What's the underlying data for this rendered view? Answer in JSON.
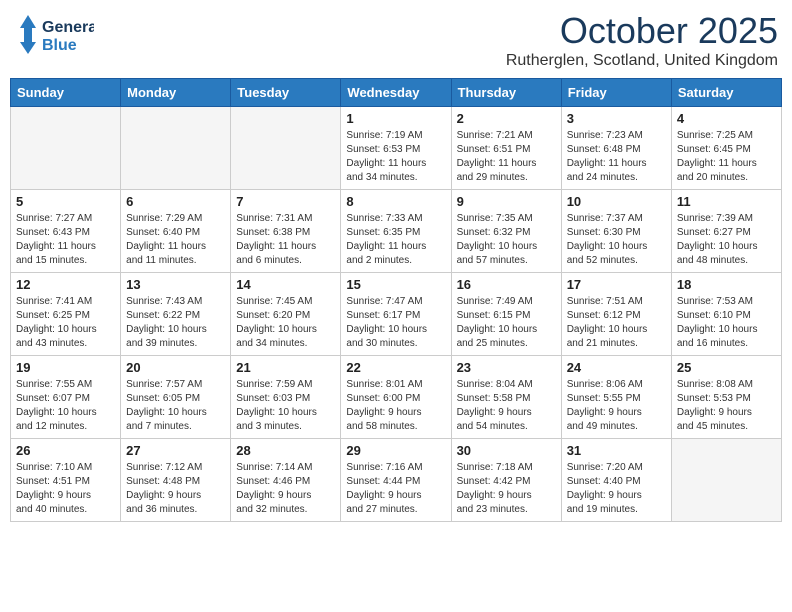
{
  "header": {
    "logo_line1": "General",
    "logo_line2": "Blue",
    "month": "October 2025",
    "location": "Rutherglen, Scotland, United Kingdom"
  },
  "days_of_week": [
    "Sunday",
    "Monday",
    "Tuesday",
    "Wednesday",
    "Thursday",
    "Friday",
    "Saturday"
  ],
  "weeks": [
    [
      {
        "day": "",
        "info": ""
      },
      {
        "day": "",
        "info": ""
      },
      {
        "day": "",
        "info": ""
      },
      {
        "day": "1",
        "info": "Sunrise: 7:19 AM\nSunset: 6:53 PM\nDaylight: 11 hours\nand 34 minutes."
      },
      {
        "day": "2",
        "info": "Sunrise: 7:21 AM\nSunset: 6:51 PM\nDaylight: 11 hours\nand 29 minutes."
      },
      {
        "day": "3",
        "info": "Sunrise: 7:23 AM\nSunset: 6:48 PM\nDaylight: 11 hours\nand 24 minutes."
      },
      {
        "day": "4",
        "info": "Sunrise: 7:25 AM\nSunset: 6:45 PM\nDaylight: 11 hours\nand 20 minutes."
      }
    ],
    [
      {
        "day": "5",
        "info": "Sunrise: 7:27 AM\nSunset: 6:43 PM\nDaylight: 11 hours\nand 15 minutes."
      },
      {
        "day": "6",
        "info": "Sunrise: 7:29 AM\nSunset: 6:40 PM\nDaylight: 11 hours\nand 11 minutes."
      },
      {
        "day": "7",
        "info": "Sunrise: 7:31 AM\nSunset: 6:38 PM\nDaylight: 11 hours\nand 6 minutes."
      },
      {
        "day": "8",
        "info": "Sunrise: 7:33 AM\nSunset: 6:35 PM\nDaylight: 11 hours\nand 2 minutes."
      },
      {
        "day": "9",
        "info": "Sunrise: 7:35 AM\nSunset: 6:32 PM\nDaylight: 10 hours\nand 57 minutes."
      },
      {
        "day": "10",
        "info": "Sunrise: 7:37 AM\nSunset: 6:30 PM\nDaylight: 10 hours\nand 52 minutes."
      },
      {
        "day": "11",
        "info": "Sunrise: 7:39 AM\nSunset: 6:27 PM\nDaylight: 10 hours\nand 48 minutes."
      }
    ],
    [
      {
        "day": "12",
        "info": "Sunrise: 7:41 AM\nSunset: 6:25 PM\nDaylight: 10 hours\nand 43 minutes."
      },
      {
        "day": "13",
        "info": "Sunrise: 7:43 AM\nSunset: 6:22 PM\nDaylight: 10 hours\nand 39 minutes."
      },
      {
        "day": "14",
        "info": "Sunrise: 7:45 AM\nSunset: 6:20 PM\nDaylight: 10 hours\nand 34 minutes."
      },
      {
        "day": "15",
        "info": "Sunrise: 7:47 AM\nSunset: 6:17 PM\nDaylight: 10 hours\nand 30 minutes."
      },
      {
        "day": "16",
        "info": "Sunrise: 7:49 AM\nSunset: 6:15 PM\nDaylight: 10 hours\nand 25 minutes."
      },
      {
        "day": "17",
        "info": "Sunrise: 7:51 AM\nSunset: 6:12 PM\nDaylight: 10 hours\nand 21 minutes."
      },
      {
        "day": "18",
        "info": "Sunrise: 7:53 AM\nSunset: 6:10 PM\nDaylight: 10 hours\nand 16 minutes."
      }
    ],
    [
      {
        "day": "19",
        "info": "Sunrise: 7:55 AM\nSunset: 6:07 PM\nDaylight: 10 hours\nand 12 minutes."
      },
      {
        "day": "20",
        "info": "Sunrise: 7:57 AM\nSunset: 6:05 PM\nDaylight: 10 hours\nand 7 minutes."
      },
      {
        "day": "21",
        "info": "Sunrise: 7:59 AM\nSunset: 6:03 PM\nDaylight: 10 hours\nand 3 minutes."
      },
      {
        "day": "22",
        "info": "Sunrise: 8:01 AM\nSunset: 6:00 PM\nDaylight: 9 hours\nand 58 minutes."
      },
      {
        "day": "23",
        "info": "Sunrise: 8:04 AM\nSunset: 5:58 PM\nDaylight: 9 hours\nand 54 minutes."
      },
      {
        "day": "24",
        "info": "Sunrise: 8:06 AM\nSunset: 5:55 PM\nDaylight: 9 hours\nand 49 minutes."
      },
      {
        "day": "25",
        "info": "Sunrise: 8:08 AM\nSunset: 5:53 PM\nDaylight: 9 hours\nand 45 minutes."
      }
    ],
    [
      {
        "day": "26",
        "info": "Sunrise: 7:10 AM\nSunset: 4:51 PM\nDaylight: 9 hours\nand 40 minutes."
      },
      {
        "day": "27",
        "info": "Sunrise: 7:12 AM\nSunset: 4:48 PM\nDaylight: 9 hours\nand 36 minutes."
      },
      {
        "day": "28",
        "info": "Sunrise: 7:14 AM\nSunset: 4:46 PM\nDaylight: 9 hours\nand 32 minutes."
      },
      {
        "day": "29",
        "info": "Sunrise: 7:16 AM\nSunset: 4:44 PM\nDaylight: 9 hours\nand 27 minutes."
      },
      {
        "day": "30",
        "info": "Sunrise: 7:18 AM\nSunset: 4:42 PM\nDaylight: 9 hours\nand 23 minutes."
      },
      {
        "day": "31",
        "info": "Sunrise: 7:20 AM\nSunset: 4:40 PM\nDaylight: 9 hours\nand 19 minutes."
      },
      {
        "day": "",
        "info": ""
      }
    ]
  ]
}
